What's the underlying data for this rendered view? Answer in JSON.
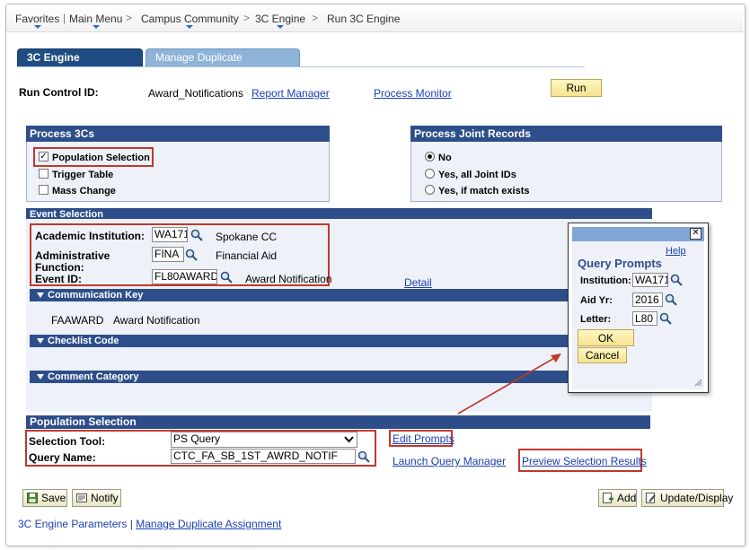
{
  "breadcrumb": {
    "items": [
      "Favorites",
      "Main Menu",
      "Campus Community",
      "3C Engine",
      "Run 3C Engine"
    ],
    "separator": ">"
  },
  "tabs": {
    "active": "3C Engine Parameters",
    "inactive": "Manage Duplicate Assignment"
  },
  "run_control": {
    "label": "Run Control ID:",
    "value": "Award_Notifications",
    "report_manager": "Report Manager",
    "process_monitor": "Process Monitor",
    "run_button": "Run"
  },
  "process_3cs": {
    "title": "Process 3Cs",
    "options": [
      {
        "label": "Population Selection",
        "checked": true
      },
      {
        "label": "Trigger Table",
        "checked": false
      },
      {
        "label": "Mass Change",
        "checked": false
      }
    ]
  },
  "joint_records": {
    "title": "Process Joint Records",
    "options": [
      {
        "label": "No",
        "selected": true
      },
      {
        "label": "Yes, all Joint IDs",
        "selected": false
      },
      {
        "label": "Yes, if match exists",
        "selected": false
      }
    ]
  },
  "event_selection": {
    "title": "Event Selection",
    "institution_label": "Academic Institution:",
    "institution_value": "WA171",
    "institution_desc": "Spokane CC",
    "admin_function_label_1": "Administrative",
    "admin_function_label_2": "Function:",
    "admin_function_value": "FINA",
    "admin_function_desc": "Financial Aid",
    "event_id_label": "Event ID:",
    "event_id_value": "FL80AWARD",
    "event_id_desc": "Award Notification",
    "detail_link": "Detail",
    "communication_key": {
      "title": "Communication Key",
      "code": "FAAWARD",
      "desc": "Award Notification"
    },
    "checklist_code": {
      "title": "Checklist Code"
    },
    "comment_category": {
      "title": "Comment Category"
    }
  },
  "population_selection": {
    "title": "Population Selection",
    "tool_label": "Selection Tool:",
    "tool_value": "PS Query",
    "query_label": "Query Name:",
    "query_value": "CTC_FA_SB_1ST_AWRD_NOTIF",
    "edit_prompts": "Edit Prompts",
    "launch_query_manager": "Launch Query Manager",
    "preview_results": "Preview Selection Results"
  },
  "query_prompts": {
    "close": "✕",
    "help": "Help",
    "title": "Query Prompts",
    "institution_label": "Institution:",
    "institution_value": "WA171",
    "aid_yr_label": "Aid Yr:",
    "aid_yr_value": "2016",
    "letter_label": "Letter:",
    "letter_value": "L80",
    "ok": "OK",
    "cancel": "Cancel"
  },
  "toolbar": {
    "save": "Save",
    "notify": "Notify",
    "add": "Add",
    "update_display": "Update/Display"
  },
  "footer": {
    "tab1": "3C Engine Parameters",
    "sep": "|",
    "tab2": "Manage Duplicate Assignment"
  },
  "colors": {
    "header_blue": "#2d4e8a",
    "annotation_red": "#c0392b",
    "link_blue": "#1a3eb3"
  }
}
